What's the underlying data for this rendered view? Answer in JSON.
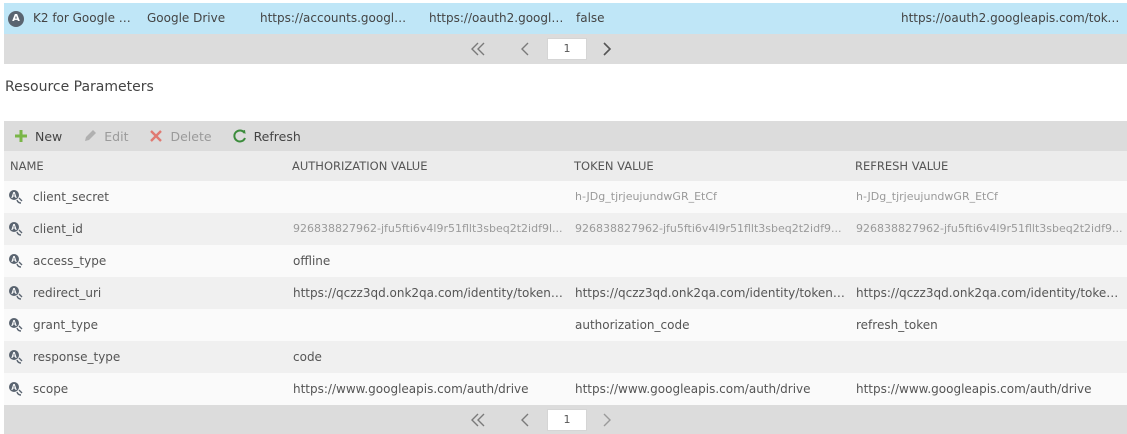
{
  "top_row": {
    "badge": "A",
    "name": "K2 for Google D...",
    "type": "Google Drive",
    "auth_url": "https://accounts.google.c...",
    "token_url": "https://oauth2.google...",
    "flag": "false",
    "refresh_url": "https://oauth2.googleapis.com/token"
  },
  "pager_top": {
    "page": "1"
  },
  "resource_params": {
    "title": "Resource Parameters",
    "toolbar": {
      "new": "New",
      "edit": "Edit",
      "delete": "Delete",
      "refresh": "Refresh"
    },
    "columns": [
      "NAME",
      "AUTHORIZATION VALUE",
      "TOKEN VALUE",
      "REFRESH VALUE"
    ],
    "rows": [
      {
        "name": "client_secret",
        "auth": "",
        "token": "h-JDg_tjrjeujundwGR_EtCf",
        "refresh": "h-JDg_tjrjeujundwGR_EtCf"
      },
      {
        "name": "client_id",
        "auth": "926838827962-jfu5fti6v4l9r51fllt3sbeq2t2idf9l...",
        "token": "926838827962-jfu5fti6v4l9r51fllt3sbeq2t2idf9...",
        "refresh": "926838827962-jfu5fti6v4l9r51fllt3sbeq2t2idf9..."
      },
      {
        "name": "access_type",
        "auth": "offline",
        "token": "",
        "refresh": ""
      },
      {
        "name": "redirect_uri",
        "auth": "https://qczz3qd.onk2qa.com/identity/token/o...",
        "token": "https://qczz3qd.onk2qa.com/identity/token/o...",
        "refresh": "https://qczz3qd.onk2qa.com/identity/token/o..."
      },
      {
        "name": "grant_type",
        "auth": "",
        "token": "authorization_code",
        "refresh": "refresh_token"
      },
      {
        "name": "response_type",
        "auth": "code",
        "token": "",
        "refresh": ""
      },
      {
        "name": "scope",
        "auth": "https://www.googleapis.com/auth/drive",
        "token": "https://www.googleapis.com/auth/drive",
        "refresh": "https://www.googleapis.com/auth/drive"
      }
    ]
  },
  "pager_bottom": {
    "page": "1"
  },
  "colors": {
    "selected_row": "#bfe6f7",
    "toolbar_bg": "#dcdcdc",
    "new_icon": "#7ab648",
    "delete_icon": "#e05a4f",
    "refresh_icon": "#3c8c3c"
  }
}
